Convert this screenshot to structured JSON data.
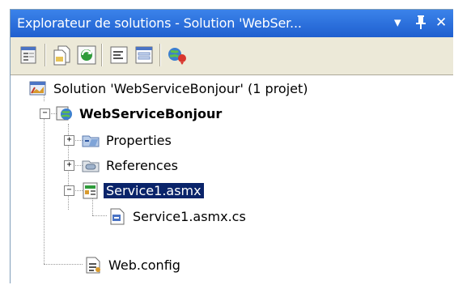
{
  "panel": {
    "title": "Explorateur de solutions - Solution 'WebSer...",
    "dropdown_glyph": "▾",
    "pin_glyph": "Ꝗ",
    "close_glyph": "✕"
  },
  "toolbar": {
    "buttons": [
      "properties-icon",
      "show-all-files-icon",
      "refresh-icon",
      "view-code-icon",
      "view-designer-icon",
      "copy-website-icon"
    ]
  },
  "tree": {
    "solution": {
      "label": "Solution 'WebServiceBonjour' (1 projet)",
      "icon": "solution-icon"
    },
    "project": {
      "label": "WebServiceBonjour",
      "icon": "web-project-icon",
      "expanded": true
    },
    "items": [
      {
        "label": "Properties",
        "icon": "properties-folder-icon",
        "expander": "+"
      },
      {
        "label": "References",
        "icon": "references-folder-icon",
        "expander": "+"
      },
      {
        "label": "Service1.asmx",
        "icon": "asmx-file-icon",
        "expander": "−",
        "selected": true
      },
      {
        "label": "Service1.asmx.cs",
        "icon": "cs-file-icon"
      },
      {
        "label": "Web.config",
        "icon": "config-file-icon"
      }
    ]
  },
  "colors": {
    "title_bar": "#2b6dd9",
    "selection": "#0a246a",
    "toolbar": "#ece9d8"
  }
}
